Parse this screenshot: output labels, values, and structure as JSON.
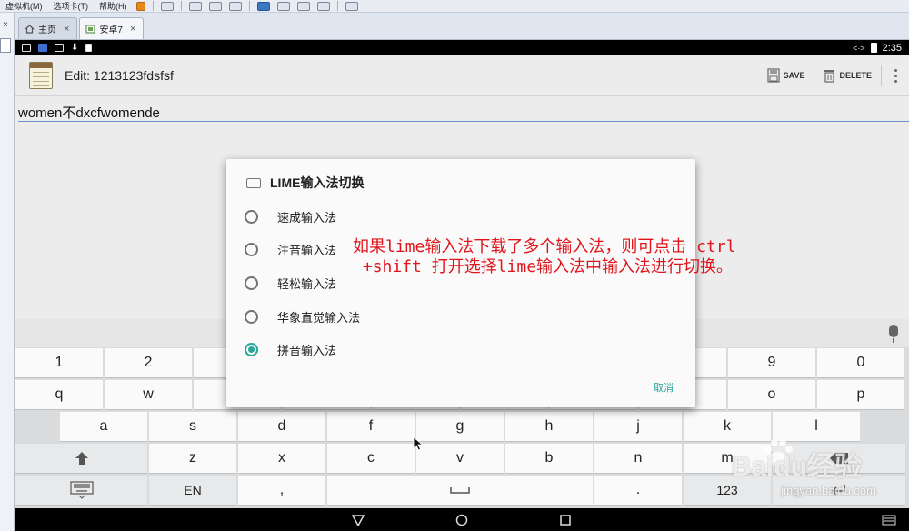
{
  "host": {
    "menu": [
      "虚拟机(M)",
      "选项卡(T)",
      "帮助(H)"
    ],
    "tabs": [
      {
        "label": "主页",
        "close": "×"
      },
      {
        "label": "安卓7",
        "close": "×"
      }
    ]
  },
  "status_bar": {
    "time": "2:35",
    "signal": "<·>"
  },
  "app_bar": {
    "title": "Edit: 1213123fdsfsf",
    "save_label": "SAVE",
    "delete_label": "DELETE"
  },
  "editor": {
    "text": "women不dxcfwomende"
  },
  "dialog": {
    "title": "LIME输入法切换",
    "options": [
      {
        "label": "速成输入法",
        "selected": false
      },
      {
        "label": "注音输入法",
        "selected": false
      },
      {
        "label": "轻松输入法",
        "selected": false
      },
      {
        "label": "华象直觉输入法",
        "selected": false
      },
      {
        "label": "拼音输入法",
        "selected": true
      }
    ],
    "cancel_label": "取消"
  },
  "annotation": {
    "line1": "如果lime输入法下载了多个输入法，则可点击 ctrl",
    "line2": " +shift 打开选择lime输入法中输入法进行切换。"
  },
  "keyboard": {
    "row1": [
      "1",
      "2",
      "",
      "",
      "",
      "",
      "",
      "",
      "9",
      "0"
    ],
    "row2": [
      "q",
      "w",
      "",
      "",
      "",
      "",
      "",
      "",
      "o",
      "p"
    ],
    "row3": [
      "a",
      "s",
      "d",
      "f",
      "g",
      "h",
      "j",
      "k",
      "l"
    ],
    "row4": [
      "",
      "z",
      "x",
      "c",
      "v",
      "b",
      "n",
      "m",
      ""
    ],
    "row5": {
      "lang": "EN",
      "comma": ",",
      "period": ".",
      "sym": "123"
    }
  },
  "watermark": {
    "brand": "Baidu经验",
    "url": "jingyan.baidu.com"
  },
  "colors": {
    "accent": "#26a69a",
    "annotation": "#e0151b"
  }
}
